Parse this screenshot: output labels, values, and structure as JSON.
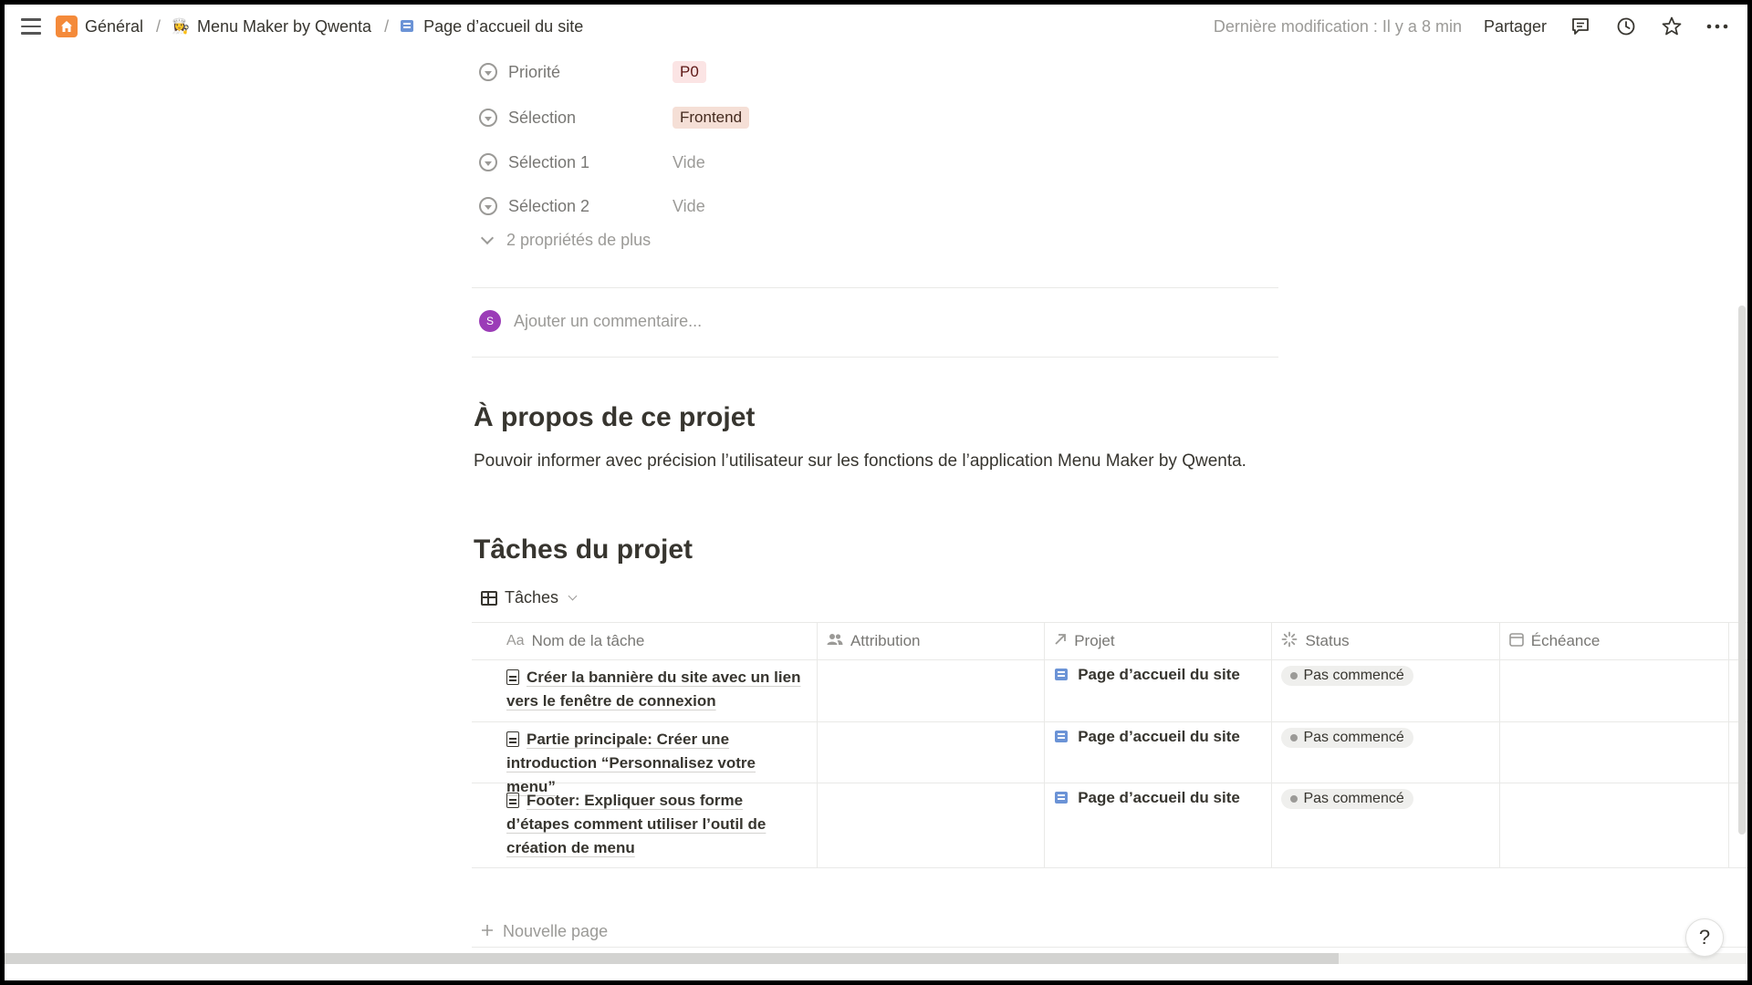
{
  "breadcrumb": {
    "items": [
      {
        "label": "Général",
        "icon": "home-icon"
      },
      {
        "label": "Menu Maker by Qwenta",
        "icon": "chef-emoji-icon"
      },
      {
        "label": "Page d’accueil du site",
        "icon": "page-icon"
      }
    ],
    "separator": "/"
  },
  "topbar": {
    "last_modified": "Dernière modification : Il y a 8 min",
    "share_label": "Partager"
  },
  "properties": [
    {
      "name": "Priorité",
      "value": "P0",
      "kind": "tag-red"
    },
    {
      "name": "Sélection",
      "value": "Frontend",
      "kind": "tag-front"
    },
    {
      "name": "Sélection 1",
      "value": "Vide",
      "kind": "empty"
    },
    {
      "name": "Sélection 2",
      "value": "Vide",
      "kind": "empty"
    }
  ],
  "more_properties": "2 propriétés de plus",
  "comment": {
    "avatar_initial": "S",
    "placeholder": "Ajouter un commentaire..."
  },
  "about": {
    "heading": "À propos de ce projet",
    "text": "Pouvoir informer avec précision l’utilisateur sur les fonctions de l’application Menu Maker by Qwenta."
  },
  "tasks": {
    "heading": "Tâches du projet",
    "view_label": "Tâches",
    "columns": [
      {
        "label": "Nom de la tâche",
        "icon": "Aa"
      },
      {
        "label": "Attribution",
        "icon": "people-icon"
      },
      {
        "label": "Projet",
        "icon": "arrow-up-right-icon"
      },
      {
        "label": "Status",
        "icon": "loading-icon"
      },
      {
        "label": "Échéance",
        "icon": "calendar-icon"
      }
    ],
    "rows": [
      {
        "name": "Créer la bannière du site avec un lien vers le fenêtre de connexion",
        "attribution": "",
        "project": "Page d’accueil du site",
        "status": "Pas commencé",
        "due": ""
      },
      {
        "name": "Partie principale: Créer une introduction “Personnalisez votre menu”",
        "attribution": "",
        "project": "Page d’accueil du site",
        "status": "Pas commencé",
        "due": ""
      },
      {
        "name": "Footer: Expliquer sous forme d’étapes comment utiliser l’outil de création de menu",
        "attribution": "",
        "project": "Page d’accueil du site",
        "status": "Pas commencé",
        "due": ""
      }
    ],
    "new_page_label": "Nouvelle page"
  },
  "help_label": "?"
}
